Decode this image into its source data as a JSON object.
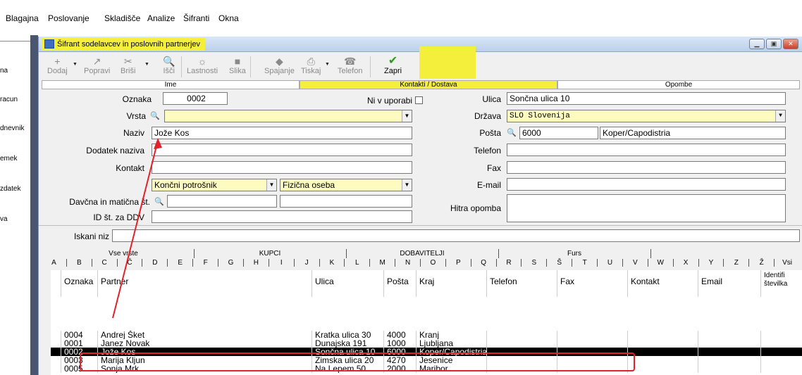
{
  "menubar": {
    "items": [
      "Blagajna",
      "Poslovanje",
      "Skladišče",
      "Analize",
      "Šifranti",
      "Okna"
    ]
  },
  "leftnav": {
    "items": [
      "na",
      "racun",
      "dnevnik",
      "emek",
      "zdatek",
      "va"
    ]
  },
  "window": {
    "title": "Šifrant sodelavcev in poslovnih partnerjev",
    "min": "▁",
    "max": "▣",
    "close": "✕"
  },
  "toolbar": {
    "buttons": [
      {
        "label": "Dodaj",
        "icon": "+"
      },
      {
        "label": "Popravi",
        "icon": "↗"
      },
      {
        "label": "Briši",
        "icon": "✂"
      },
      {
        "label": "Išči",
        "icon": "🔍"
      },
      {
        "label": "Lastnosti",
        "icon": "☼"
      },
      {
        "label": "Slika",
        "icon": "■"
      },
      {
        "label": "Spajanje",
        "icon": "◆"
      },
      {
        "label": "Tiskaj",
        "icon": "⎙"
      },
      {
        "label": "Telefon",
        "icon": "☎"
      },
      {
        "label": "Zapri",
        "icon": "✔"
      }
    ]
  },
  "tabs": {
    "ime": "Ime",
    "kontakti": "Kontakti / Dostava",
    "opombe": "Opombe"
  },
  "form": {
    "oznaka_label": "Oznaka",
    "oznaka": "0002",
    "ni_v_uporabi": "Ni v uporabi",
    "vrsta_label": "Vrsta",
    "vrsta": "",
    "naziv_label": "Naziv",
    "naziv": "Jože Kos",
    "dodatek_label": "Dodatek naziva",
    "dodatek": "",
    "kontakt_label": "Kontakt",
    "kontakt": "",
    "tip1": "Končni potrošnik",
    "tip2": "Fizična oseba",
    "davcna_label": "Davčna in matična št.",
    "davcna": "",
    "maticna": "",
    "idddv_label": "ID št. za DDV",
    "idddv": "",
    "ulica_label": "Ulica",
    "ulica": "Sončna ulica 10",
    "drzava_label": "Država",
    "drzava": "SLO  Slovenija",
    "posta_label": "Pošta",
    "posta": "6000",
    "kraj": "Koper/Capodistria",
    "telefon_label": "Telefon",
    "telefon": "",
    "fax_label": "Fax",
    "fax": "",
    "email_label": "E-mail",
    "email": "",
    "hitra_label": "Hitra opomba",
    "hitra": ""
  },
  "search": {
    "label": "Iskani niz",
    "value": ""
  },
  "filter_tabs": [
    "Vse vrste",
    "KUPCI",
    "DOBAVITELJI",
    "Furs"
  ],
  "alphabet": [
    "A",
    "B",
    "C",
    "Č",
    "D",
    "E",
    "F",
    "G",
    "H",
    "I",
    "J",
    "K",
    "L",
    "M",
    "N",
    "O",
    "P",
    "Q",
    "R",
    "S",
    "Š",
    "T",
    "U",
    "V",
    "W",
    "X",
    "Y",
    "Z",
    "Ž",
    "Vsi"
  ],
  "table": {
    "columns": [
      "Oznaka",
      "Partner",
      "Ulica",
      "Pošta",
      "Kraj",
      "Telefon",
      "Fax",
      "Kontakt",
      "Email",
      "Identifi številka"
    ],
    "rows": [
      [
        "0004",
        "Andrej Šket",
        "Kratka ulica 30",
        "4000",
        "Kranj",
        "",
        "",
        "",
        "",
        ""
      ],
      [
        "0001",
        "Janez Novak",
        "Dunajska 191",
        "1000",
        "Ljubljana",
        "",
        "",
        "",
        "",
        ""
      ],
      [
        "0002",
        "Jože Kos",
        "Sončna ulica 10",
        "6000",
        "Koper/Capodistria",
        "",
        "",
        "",
        "",
        ""
      ],
      [
        "0003",
        "Marija Kljun",
        "Zimska ulica 20",
        "4270",
        "Jesenice",
        "",
        "",
        "",
        "",
        ""
      ],
      [
        "0005",
        "Sonja Mrk",
        "Na Lepem 50",
        "2000",
        "Maribor",
        "",
        "",
        "",
        "",
        ""
      ]
    ],
    "selected_index": 2
  }
}
